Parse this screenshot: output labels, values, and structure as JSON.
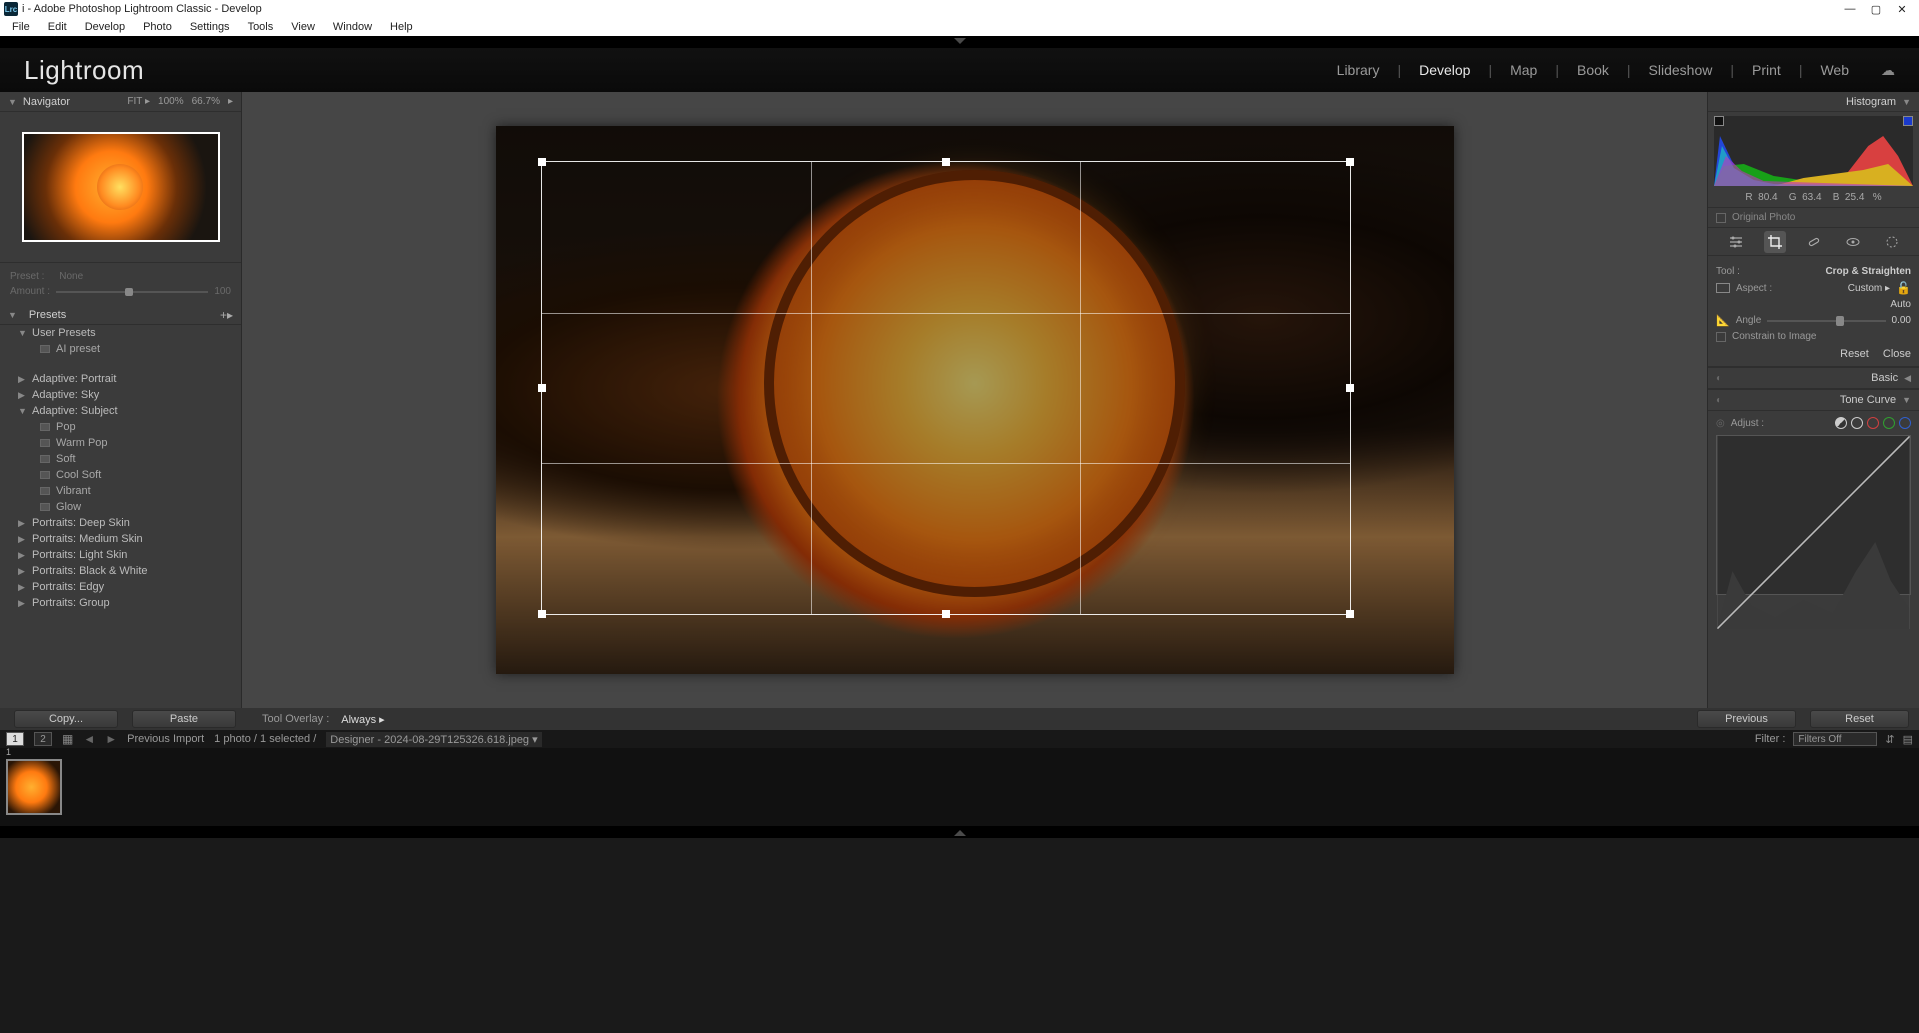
{
  "titlebar": {
    "badge": "Lrc",
    "title": "i - Adobe Photoshop Lightroom Classic - Develop"
  },
  "menu": [
    "File",
    "Edit",
    "Develop",
    "Photo",
    "Settings",
    "Tools",
    "View",
    "Window",
    "Help"
  ],
  "header": {
    "logo": "Lightroom",
    "modules": [
      "Library",
      "Develop",
      "Map",
      "Book",
      "Slideshow",
      "Print",
      "Web"
    ],
    "active_module": "Develop"
  },
  "navigator": {
    "title": "Navigator",
    "zoom_fit": "FIT",
    "zoom_100": "100%",
    "zoom_667": "66.7%"
  },
  "slider": {
    "preset_label": "Preset :",
    "preset_value": "None",
    "amount_label": "Amount :",
    "amount_value": "100"
  },
  "presets": {
    "title": "Presets",
    "groups": [
      {
        "label": "User Presets",
        "expanded": true,
        "items": [
          "AI preset"
        ]
      },
      {
        "label": "Adaptive: Portrait",
        "expanded": false,
        "items": []
      },
      {
        "label": "Adaptive: Sky",
        "expanded": false,
        "items": []
      },
      {
        "label": "Adaptive: Subject",
        "expanded": true,
        "items": [
          "Pop",
          "Warm Pop",
          "Soft",
          "Cool Soft",
          "Vibrant",
          "Glow"
        ]
      },
      {
        "label": "Portraits: Deep Skin",
        "expanded": false,
        "items": []
      },
      {
        "label": "Portraits: Medium Skin",
        "expanded": false,
        "items": []
      },
      {
        "label": "Portraits: Light Skin",
        "expanded": false,
        "items": []
      },
      {
        "label": "Portraits: Black & White",
        "expanded": false,
        "items": []
      },
      {
        "label": "Portraits: Edgy",
        "expanded": false,
        "items": []
      },
      {
        "label": "Portraits: Group",
        "expanded": false,
        "items": []
      }
    ]
  },
  "copy_paste": {
    "copy": "Copy...",
    "paste": "Paste"
  },
  "tool_overlay": {
    "label": "Tool Overlay :",
    "value": "Always"
  },
  "prev_reset": {
    "previous": "Previous",
    "reset": "Reset"
  },
  "histogram": {
    "title": "Histogram",
    "rgb": {
      "r_label": "R",
      "r": "80.4",
      "g_label": "G",
      "g": "63.4",
      "b_label": "B",
      "b": "25.4",
      "pct": "%"
    },
    "original": "Original Photo"
  },
  "tools": {
    "tool_label": "Tool :",
    "tool_name": "Crop & Straighten",
    "aspect_label": "Aspect :",
    "aspect_value": "Custom",
    "auto": "Auto",
    "angle_label": "Angle",
    "angle_value": "0.00",
    "constrain": "Constrain to Image",
    "reset": "Reset",
    "close": "Close"
  },
  "sections": {
    "basic": "Basic",
    "tonecurve": "Tone Curve"
  },
  "tonecurve": {
    "adjust": "Adjust :"
  },
  "infostrip": {
    "view1": "1",
    "view2": "2",
    "prev_import": "Previous Import",
    "count": "1 photo / 1 selected /",
    "filename": "Designer - 2024-08-29T125326.618.jpeg",
    "filter_label": "Filter :",
    "filter_value": "Filters Off"
  },
  "filmstrip": {
    "thumb_index": "1"
  }
}
